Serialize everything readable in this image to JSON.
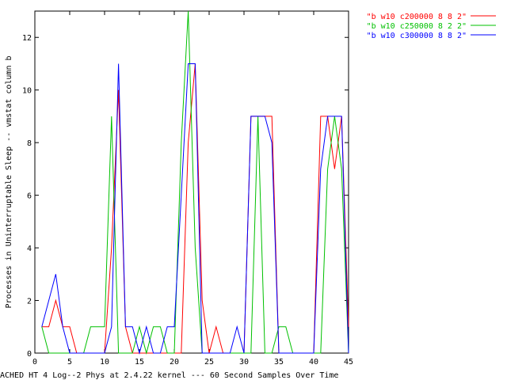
{
  "chart_data": {
    "type": "line",
    "title": "",
    "xlabel": "ACHED HT 4 Log--2 Phys at 2.4.22 kernel --- 60 Second Samples Over Time",
    "ylabel": "Processes in Uninterruptable Sleep -- vmstat column b",
    "xlim": [
      0,
      45
    ],
    "ylim": [
      0,
      13
    ],
    "xticks": [
      0,
      5,
      10,
      15,
      20,
      25,
      30,
      35,
      40,
      45
    ],
    "yticks": [
      0,
      2,
      4,
      6,
      8,
      10,
      12
    ],
    "grid": false,
    "legend_position": "outside-top-right",
    "series": [
      {
        "name": "\"b w10 c200000 8 8 2\"",
        "color": "#ff0000",
        "points": [
          [
            1,
            1
          ],
          [
            2,
            1
          ],
          [
            3,
            2
          ],
          [
            4,
            1
          ],
          [
            5,
            1
          ],
          [
            6,
            0
          ],
          [
            7,
            0
          ],
          [
            8,
            0
          ],
          [
            9,
            0
          ],
          [
            10,
            0
          ],
          [
            11,
            4
          ],
          [
            12,
            10
          ],
          [
            13,
            1
          ],
          [
            14,
            0
          ],
          [
            15,
            0
          ],
          [
            16,
            0
          ],
          [
            17,
            0
          ],
          [
            18,
            0
          ],
          [
            19,
            0
          ],
          [
            20,
            0
          ],
          [
            21,
            0
          ],
          [
            22,
            8
          ],
          [
            23,
            11
          ],
          [
            24,
            2
          ],
          [
            25,
            0
          ],
          [
            26,
            1
          ],
          [
            27,
            0
          ],
          [
            28,
            0
          ],
          [
            29,
            0
          ],
          [
            30,
            0
          ],
          [
            31,
            9
          ],
          [
            32,
            9
          ],
          [
            33,
            9
          ],
          [
            34,
            9
          ],
          [
            35,
            0
          ],
          [
            36,
            0
          ],
          [
            37,
            0
          ],
          [
            38,
            0
          ],
          [
            39,
            0
          ],
          [
            40,
            0
          ],
          [
            41,
            9
          ],
          [
            42,
            9
          ],
          [
            43,
            7
          ],
          [
            44,
            9
          ],
          [
            45,
            1
          ]
        ]
      },
      {
        "name": "\"b w10 c250000 8 2 2\"",
        "color": "#00c000",
        "points": [
          [
            1,
            1
          ],
          [
            2,
            0
          ],
          [
            3,
            0
          ],
          [
            4,
            0
          ],
          [
            5,
            0
          ],
          [
            6,
            0
          ],
          [
            7,
            0
          ],
          [
            8,
            1
          ],
          [
            9,
            1
          ],
          [
            10,
            1
          ],
          [
            11,
            9
          ],
          [
            12,
            0
          ],
          [
            13,
            0
          ],
          [
            14,
            0
          ],
          [
            15,
            1
          ],
          [
            16,
            0
          ],
          [
            17,
            1
          ],
          [
            18,
            1
          ],
          [
            19,
            0
          ],
          [
            20,
            0
          ],
          [
            21,
            8
          ],
          [
            22,
            13
          ],
          [
            23,
            4
          ],
          [
            24,
            0
          ],
          [
            25,
            0
          ],
          [
            26,
            0
          ],
          [
            27,
            0
          ],
          [
            28,
            0
          ],
          [
            29,
            0
          ],
          [
            30,
            0
          ],
          [
            31,
            0
          ],
          [
            32,
            9
          ],
          [
            33,
            0
          ],
          [
            34,
            0
          ],
          [
            35,
            1
          ],
          [
            36,
            1
          ],
          [
            37,
            0
          ],
          [
            38,
            0
          ],
          [
            39,
            0
          ],
          [
            40,
            0
          ],
          [
            41,
            0
          ],
          [
            42,
            7
          ],
          [
            43,
            9
          ],
          [
            44,
            7
          ],
          [
            45,
            0
          ]
        ]
      },
      {
        "name": "\"b w10 c300000 8 8 2\"",
        "color": "#0000ff",
        "points": [
          [
            1,
            1
          ],
          [
            2,
            2
          ],
          [
            3,
            3
          ],
          [
            4,
            1
          ],
          [
            5,
            0
          ],
          [
            6,
            0
          ],
          [
            7,
            0
          ],
          [
            8,
            0
          ],
          [
            9,
            0
          ],
          [
            10,
            0
          ],
          [
            11,
            1
          ],
          [
            12,
            11
          ],
          [
            13,
            1
          ],
          [
            14,
            1
          ],
          [
            15,
            0
          ],
          [
            16,
            1
          ],
          [
            17,
            0
          ],
          [
            18,
            0
          ],
          [
            19,
            1
          ],
          [
            20,
            1
          ],
          [
            21,
            6
          ],
          [
            22,
            11
          ],
          [
            23,
            11
          ],
          [
            24,
            0
          ],
          [
            25,
            0
          ],
          [
            26,
            0
          ],
          [
            27,
            0
          ],
          [
            28,
            0
          ],
          [
            29,
            1
          ],
          [
            30,
            0
          ],
          [
            31,
            9
          ],
          [
            32,
            9
          ],
          [
            33,
            9
          ],
          [
            34,
            8
          ],
          [
            35,
            0
          ],
          [
            36,
            0
          ],
          [
            37,
            0
          ],
          [
            38,
            0
          ],
          [
            39,
            0
          ],
          [
            40,
            0
          ],
          [
            41,
            7
          ],
          [
            42,
            9
          ],
          [
            43,
            9
          ],
          [
            44,
            9
          ],
          [
            45,
            0
          ]
        ]
      }
    ]
  }
}
